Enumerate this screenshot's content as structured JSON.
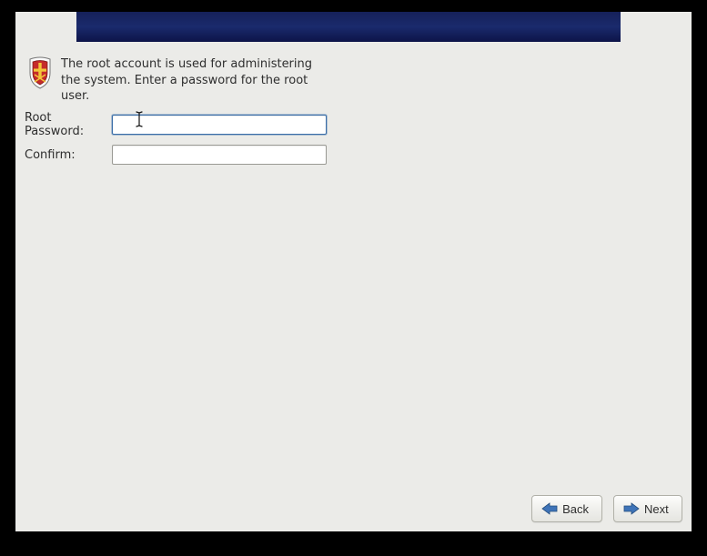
{
  "intro_text": "The root account is used for administering the system.  Enter a password for the root user.",
  "form": {
    "root_password_label": "Root Password:",
    "confirm_label": "Confirm:",
    "root_password_value": "",
    "confirm_value": ""
  },
  "buttons": {
    "back_label": "Back",
    "next_label": "Next"
  },
  "colors": {
    "header_gradient_start": "#16215a",
    "header_gradient_end": "#0d1448",
    "background": "#ebebe8",
    "arrow_fill": "#3a6ea8"
  },
  "icons": {
    "shield": "shield-icon",
    "back_arrow": "arrow-left-icon",
    "next_arrow": "arrow-right-icon",
    "text_cursor": "text-cursor-icon"
  }
}
